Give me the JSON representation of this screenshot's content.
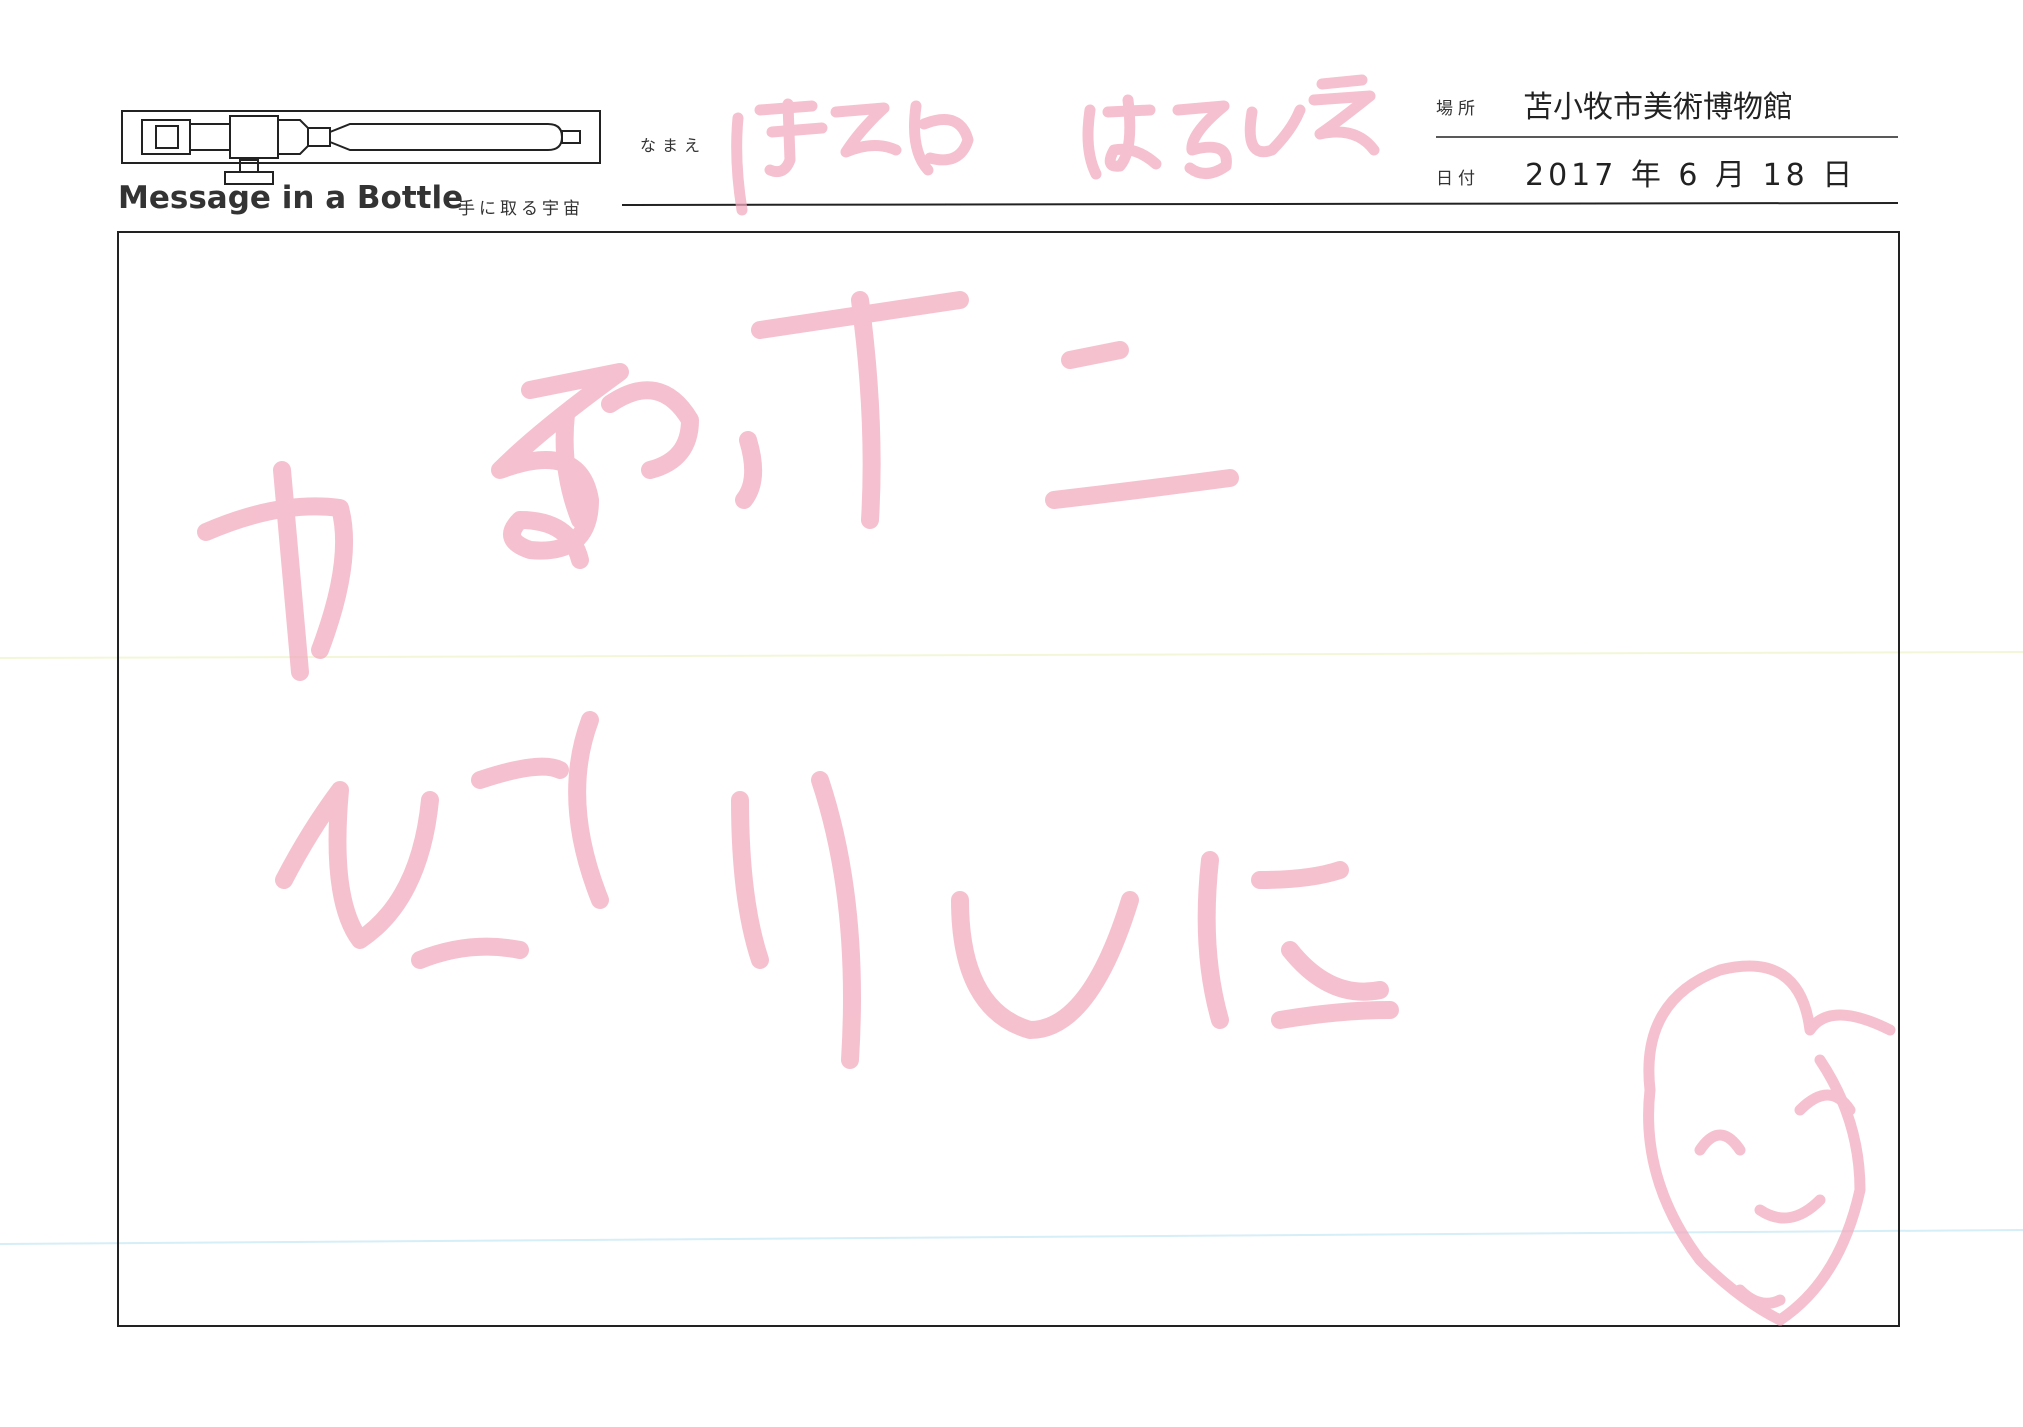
{
  "header": {
    "brand_title": "Message in a Bottle",
    "brand_subtitle": "手に取る宇宙",
    "name_label": "なまえ",
    "name_value": "ほそやはるひさ",
    "place_label": "場所",
    "place_value": "苫小牧市美術博物館",
    "date_label": "日付",
    "date_value": "2017 年 6 月 18 日"
  },
  "message": {
    "line1": "かるかったこ",
    "line2": "びっくりした"
  },
  "colors": {
    "ink": "#f2a9bd",
    "rule": "#222222",
    "guide_yellow": "#f3f7d8",
    "guide_cyan": "#d6eef7"
  },
  "icons": [
    "bottle-logo-icon",
    "hand-drawn-face-icon"
  ]
}
